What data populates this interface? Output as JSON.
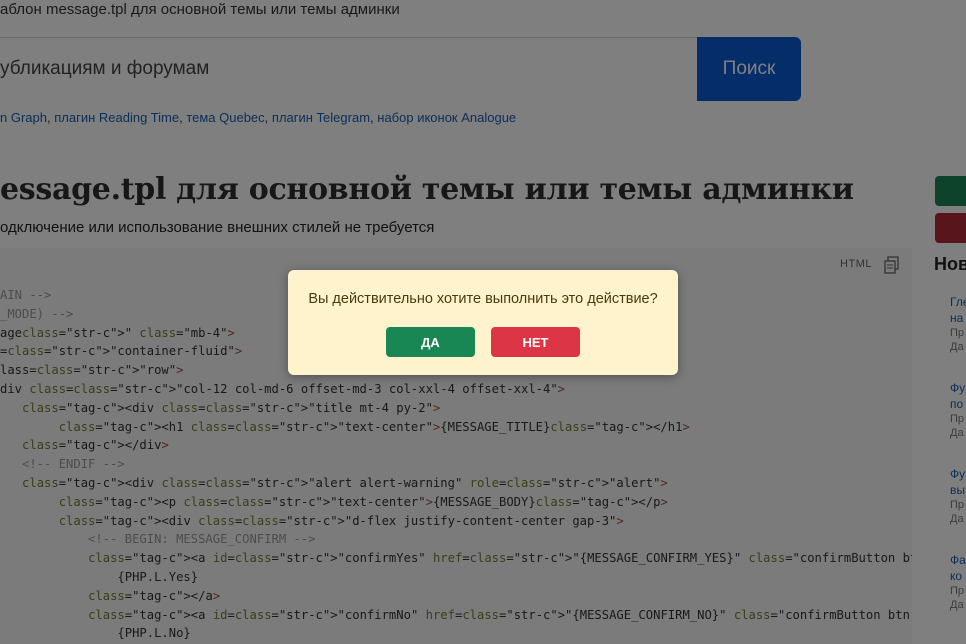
{
  "breadcrumb": "аблон message.tpl для основной темы или темы админки",
  "search": {
    "placeholder": "убликациям и форумам",
    "button_label": "Поиск"
  },
  "tags": [
    {
      "text": "n Graph"
    },
    {
      "text": "плагин Reading Time"
    },
    {
      "text": "тема Quebec"
    },
    {
      "text": "плагин Telegram"
    },
    {
      "text": "набор иконок Analogue"
    }
  ],
  "article": {
    "title": "essage.tpl для основной темы или темы админки",
    "subtitle": "одключение или использование внешних стилей не требуется"
  },
  "code": {
    "language": "HTML",
    "lines": [
      "AIN -->",
      "_MODE) -->",
      "age\" class=\"mb-4\">",
      "=\"container-fluid\">",
      "lass=\"row\">",
      "div class=\"col-12 col-md-6 offset-md-3 col-xxl-4 offset-xxl-4\">",
      "   <div class=\"title mt-4 py-2\">",
      "        <h1 class=\"text-center\">{MESSAGE_TITLE}</h1>",
      "   </div>",
      "   <!-- ENDIF -->",
      "   <div class=\"alert alert-warning\" role=\"alert\">",
      "        <p class=\"text-center\">{MESSAGE_BODY}</p>",
      "        <div class=\"d-flex justify-content-center gap-3\">",
      "            <!-- BEGIN: MESSAGE_CONFIRM -->",
      "            <a id=\"confirmYes\" href=\"{MESSAGE_CONFIRM_YES}\" class=\"confirmButton btn btn-success btn-sm fw-bold text-",
      "                {PHP.L.Yes}",
      "            </a>",
      "            <a id=\"confirmNo\" href=\"{MESSAGE_CONFIRM_NO}\" class=\"confirmButton btn btn-danger btn-sm bold fw-bold tex",
      "                {PHP.L.No}"
    ]
  },
  "sidebar": {
    "title": "Нов",
    "items": [
      {
        "link1": "Гле",
        "link2": "на",
        "meta1": "Пр",
        "meta2": "Да"
      },
      {
        "link1": "Фу",
        "link2": "по",
        "meta1": "Пр",
        "meta2": "Да"
      },
      {
        "link1": "Фу",
        "link2": "вы",
        "meta1": "Пр",
        "meta2": "Да"
      },
      {
        "link1": "Фа",
        "link2": "ко",
        "meta1": "Пр",
        "meta2": "Да"
      }
    ]
  },
  "dialog": {
    "message": "Вы действительно хотите выполнить это действие?",
    "yes_label": "ДА",
    "no_label": "НЕТ"
  },
  "colors": {
    "primary": "#0a5ad4",
    "success": "#198754",
    "danger": "#dc3545",
    "dialog_bg": "#fff3cd"
  }
}
